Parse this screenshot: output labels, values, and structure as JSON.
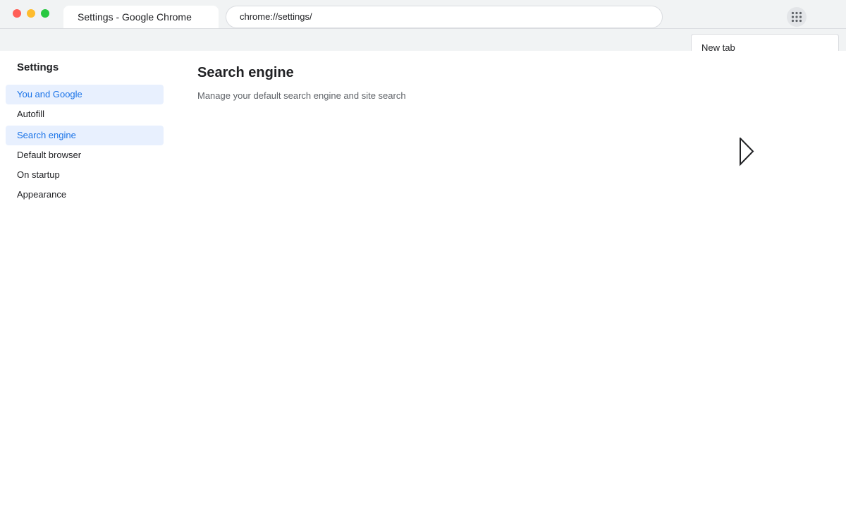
{
  "window": {
    "tab_title": "Settings - Google Chrome",
    "url": "chrome://settings/"
  },
  "toolbar": {
    "apps_icon": "apps-grid-icon"
  },
  "menu_popup": {
    "items": [
      {
        "label": "New tab"
      }
    ]
  },
  "sidebar": {
    "title": "Settings",
    "items": [
      {
        "label": "You and Google",
        "selected": true
      },
      {
        "label": "Autofill",
        "selected": false
      },
      {
        "label": "Search engine",
        "selected": true
      },
      {
        "label": "Default browser",
        "selected": false
      },
      {
        "label": "On startup",
        "selected": false
      },
      {
        "label": "Appearance",
        "selected": false
      }
    ]
  },
  "main": {
    "title": "Search engine",
    "subtitle": "Manage your default search engine and site search"
  },
  "colors": {
    "accent": "#1a73e8",
    "selected_bg": "#e8f0fe",
    "chrome_bg": "#f1f3f4"
  }
}
